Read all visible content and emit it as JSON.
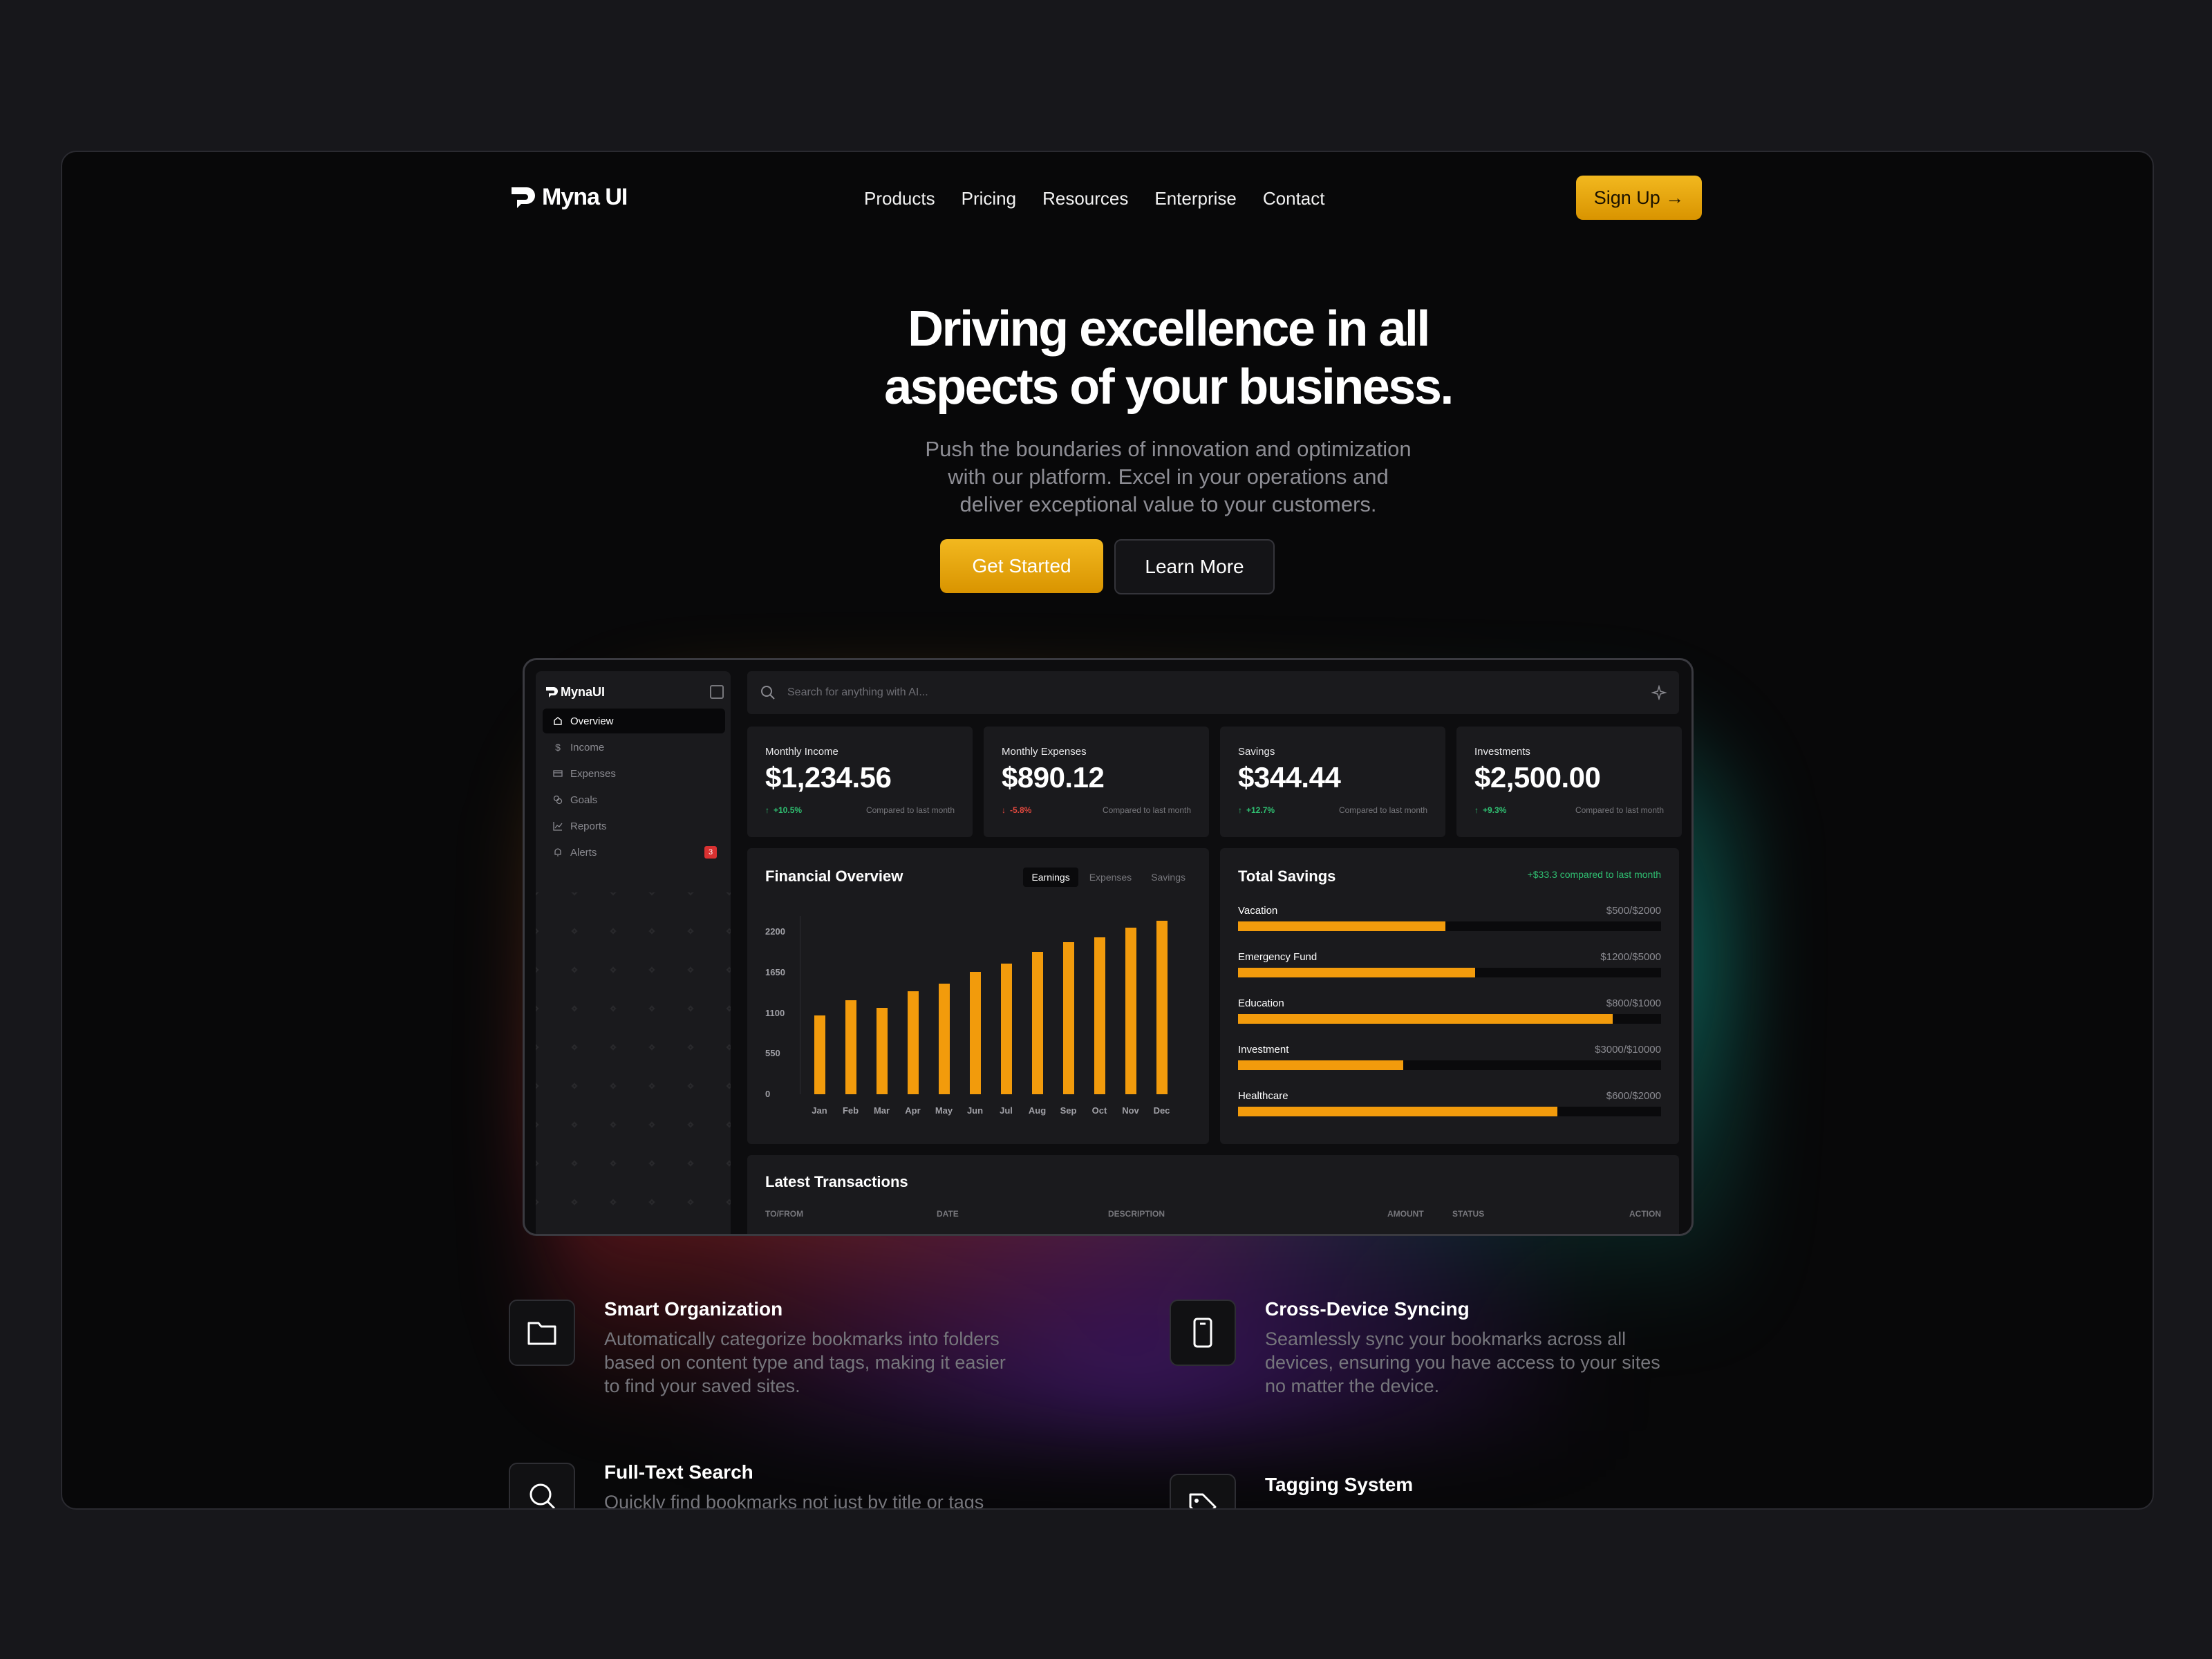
{
  "brand": {
    "name": "Myna UI"
  },
  "nav": {
    "items": [
      "Products",
      "Pricing",
      "Resources",
      "Enterprise",
      "Contact"
    ],
    "signup_label": "Sign Up →"
  },
  "hero": {
    "title_line1": "Driving excellence in all",
    "title_line2": "aspects of your business.",
    "subtitle_line1": "Push the boundaries of innovation and optimization",
    "subtitle_line2": "with our platform. Excel in your operations and",
    "subtitle_line3": "deliver exceptional value to your customers.",
    "primary_cta": "Get Started",
    "secondary_cta": "Learn More"
  },
  "dashboard": {
    "brand": "MynaUI",
    "search_placeholder": "Search for anything with AI...",
    "sidebar": [
      {
        "label": "Overview",
        "icon": "home-icon",
        "active": true
      },
      {
        "label": "Income",
        "icon": "dollar-icon"
      },
      {
        "label": "Expenses",
        "icon": "card-icon"
      },
      {
        "label": "Goals",
        "icon": "goal-icon"
      },
      {
        "label": "Reports",
        "icon": "chart-line-icon"
      },
      {
        "label": "Alerts",
        "icon": "bell-icon",
        "badge": "3"
      }
    ],
    "stats": [
      {
        "label": "Monthly Income",
        "value": "$1,234.56",
        "change": "+10.5%",
        "direction": "up",
        "compare": "Compared to last month"
      },
      {
        "label": "Monthly Expenses",
        "value": "$890.12",
        "change": "-5.8%",
        "direction": "down",
        "compare": "Compared to last month"
      },
      {
        "label": "Savings",
        "value": "$344.44",
        "change": "+12.7%",
        "direction": "up",
        "compare": "Compared to last month"
      },
      {
        "label": "Investments",
        "value": "$2,500.00",
        "change": "+9.3%",
        "direction": "up",
        "compare": "Compared to last month"
      }
    ],
    "financial_overview": {
      "title": "Financial Overview",
      "tabs": [
        "Earnings",
        "Expenses",
        "Savings"
      ],
      "active_tab": "Earnings"
    },
    "total_savings": {
      "title": "Total Savings",
      "note": "+$33.3 compared to last month",
      "goals": [
        {
          "name": "Vacation",
          "amount": "$500/$2000",
          "progress": 0.49
        },
        {
          "name": "Emergency Fund",
          "amount": "$1200/$5000",
          "progress": 0.56
        },
        {
          "name": "Education",
          "amount": "$800/$1000",
          "progress": 0.885
        },
        {
          "name": "Investment",
          "amount": "$3000/$10000",
          "progress": 0.39
        },
        {
          "name": "Healthcare",
          "amount": "$600/$2000",
          "progress": 0.755
        }
      ]
    },
    "transactions": {
      "title": "Latest Transactions",
      "columns": [
        "TO/FROM",
        "DATE",
        "DESCRIPTION",
        "AMOUNT",
        "STATUS",
        "ACTION"
      ]
    }
  },
  "chart_data": {
    "type": "bar",
    "title": "",
    "categories": [
      "Jan",
      "Feb",
      "Mar",
      "Apr",
      "May",
      "Jun",
      "Jul",
      "Aug",
      "Sep",
      "Oct",
      "Nov",
      "Dec"
    ],
    "values": [
      1070,
      1280,
      1170,
      1400,
      1500,
      1660,
      1770,
      1930,
      2060,
      2130,
      2260,
      2350
    ],
    "yticks": [
      "2200",
      "1650",
      "1100",
      "550",
      "0"
    ],
    "ylim": [
      0,
      2420
    ],
    "grid": false,
    "colors": {
      "bar": "#f29b0c"
    }
  },
  "features": [
    {
      "title": "Smart Organization",
      "icon": "folder-icon",
      "desc": [
        "Automatically categorize bookmarks into folders",
        "based on content type and tags, making it easier",
        "to find your saved sites."
      ]
    },
    {
      "title": "Cross-Device Syncing",
      "icon": "phone-icon",
      "desc": [
        "Seamlessly sync your bookmarks across all",
        "devices, ensuring you have access to your sites",
        "no matter the device."
      ]
    },
    {
      "title": "Full-Text Search",
      "icon": "search-icon",
      "desc": [
        "Quickly find bookmarks not just by title or tags"
      ]
    },
    {
      "title": "Tagging System",
      "icon": "tag-icon",
      "desc": []
    }
  ],
  "colors": {
    "accent": "#f2b81f",
    "bar": "#f29b0c",
    "up": "#2fbf71",
    "down": "#e0483e",
    "background": "#080809"
  }
}
